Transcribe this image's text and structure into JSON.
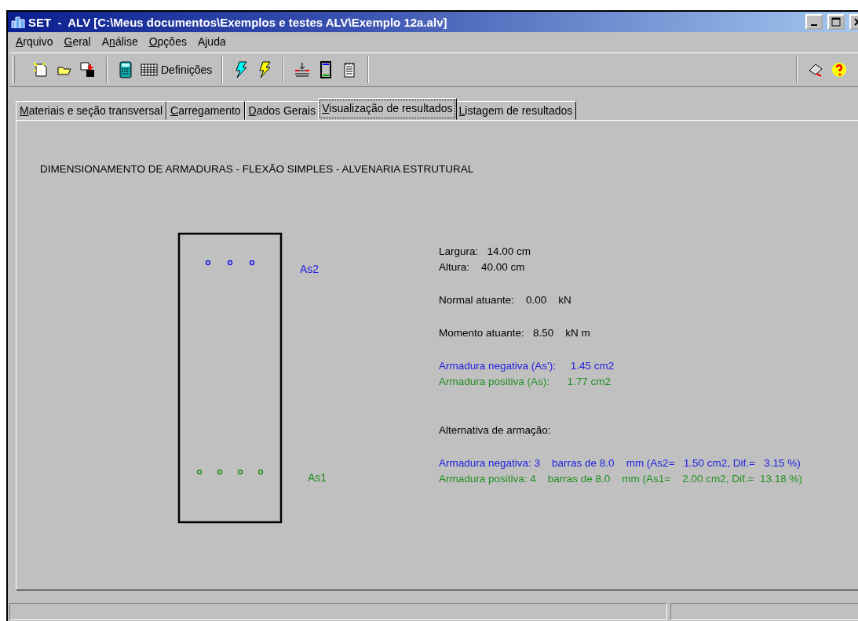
{
  "window": {
    "title": "SET  -  ALV [C:\\Meus documentos\\Exemplos e testes ALV\\Exemplo 12a.alv]"
  },
  "menu": [
    {
      "key": "A",
      "after": "rquivo"
    },
    {
      "key": "G",
      "after": "eral"
    },
    {
      "before": "A",
      "key": "n",
      "after": "álise"
    },
    {
      "key": "O",
      "after": "pções"
    },
    {
      "label": "Ajuda"
    }
  ],
  "toolbar": [
    {
      "kind": "new"
    },
    {
      "kind": "open"
    },
    {
      "kind": "save"
    },
    {
      "kind": "sep"
    },
    {
      "kind": "calculator"
    },
    {
      "kind": "grid",
      "label": "Definições"
    },
    {
      "kind": "sep"
    },
    {
      "kind": "bolt-cyan"
    },
    {
      "kind": "bolt-yellow"
    },
    {
      "kind": "sep"
    },
    {
      "kind": "beam"
    },
    {
      "kind": "section"
    },
    {
      "kind": "notepad"
    },
    {
      "kind": "sep"
    }
  ],
  "toolbar_right": [
    {
      "kind": "printer"
    },
    {
      "kind": "help"
    }
  ],
  "tabs": [
    {
      "label": "Materiais e seção transversal",
      "selected": false
    },
    {
      "label": "Carregamento",
      "selected": false
    },
    {
      "label": "Dados Gerais",
      "selected": false
    },
    {
      "label": "Visualização de resultados",
      "selected": true
    },
    {
      "label": "Listagem de resultados",
      "selected": false
    }
  ],
  "heading": "DIMENSIONAMENTO DE ARMADURAS - FLEXÃO SIMPLES - ALVENARIA ESTRUTURAL",
  "section": {
    "top": {
      "label": "As2",
      "color": "#2020e0",
      "bars": [
        {
          "kind": "bar"
        },
        {
          "kind": "bar"
        },
        {
          "kind": "bar"
        }
      ]
    },
    "bottom": {
      "label": "As1",
      "color": "#209020",
      "bars": [
        {
          "kind": "bar"
        },
        {
          "kind": "bar"
        },
        {
          "kind": "bar"
        },
        {
          "kind": "bar"
        }
      ]
    }
  },
  "results": {
    "groups": [
      [
        {
          "text": "Largura:   14.00 cm",
          "color": "#000000"
        },
        {
          "text": "Altura:    40.00 cm",
          "color": "#000000"
        }
      ],
      [
        {
          "text": "Normal atuante:    0.00    kN",
          "color": "#000000"
        }
      ],
      [
        {
          "text": "Momento atuante:   8.50    kN m",
          "color": "#000000"
        }
      ],
      [
        {
          "text": "Armadura negativa (As'):     1.45 cm2",
          "color": "#2020e0"
        },
        {
          "text": "Armadura positiva (As):      1.77 cm2",
          "color": "#209020"
        }
      ]
    ],
    "alternative": {
      "title": "Alternativa de armação:",
      "lines": [
        {
          "text": "Armadura negativa: 3    barras de 8.0    mm (As2=   1.50 cm2, Dif.=   3.15 %)",
          "color": "#2020e0"
        },
        {
          "text": "Armadura positiva: 4    barras de 8.0    mm (As1=    2.00 cm2, Dif.=  13.18 %)",
          "color": "#209020"
        }
      ]
    }
  }
}
